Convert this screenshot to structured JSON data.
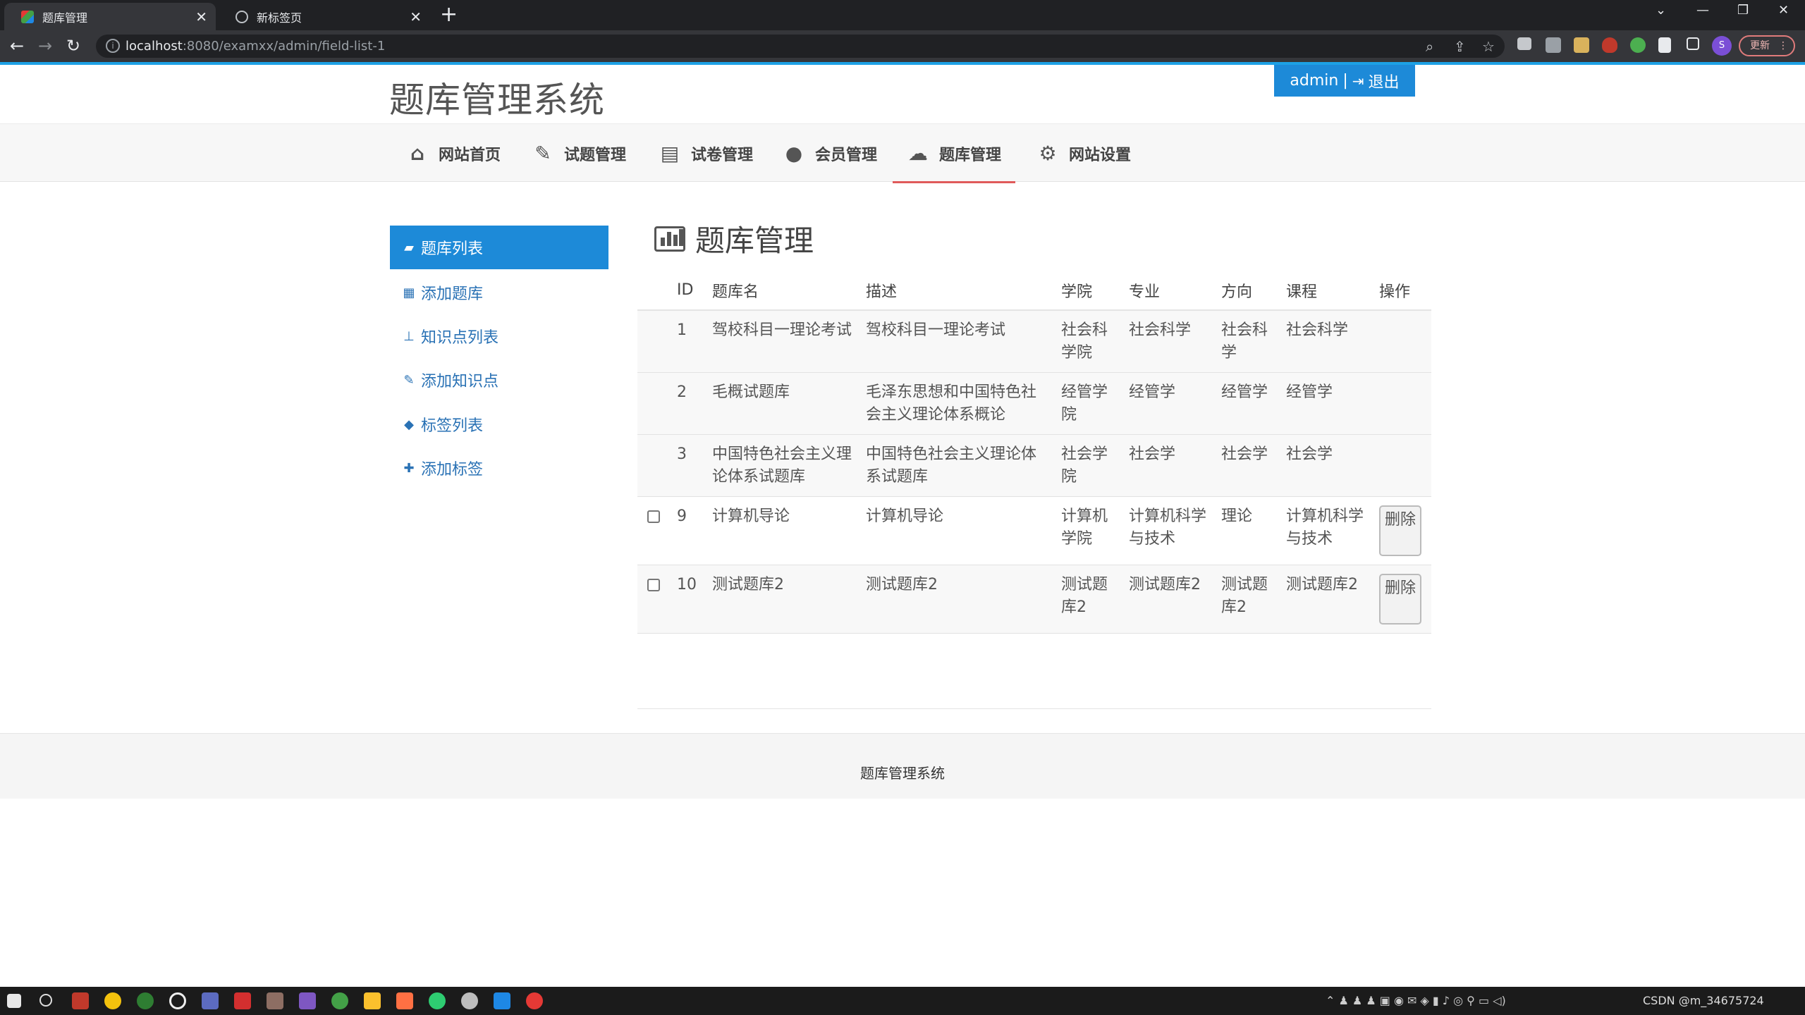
{
  "browser": {
    "tabs": [
      {
        "title": "题库管理",
        "active": true
      },
      {
        "title": "新标签页",
        "active": false
      }
    ],
    "new_tab": "+",
    "url_host": "localhost",
    "url_rest": ":8080/examxx/admin/field-list-1",
    "update_label": "更新",
    "profile_initial": "S"
  },
  "header": {
    "site_title": "题库管理系统",
    "user": "admin",
    "separator": "|",
    "logout": "退出"
  },
  "nav": {
    "items": [
      {
        "label": "网站首页",
        "icon": "home-icon"
      },
      {
        "label": "试题管理",
        "icon": "edit-icon"
      },
      {
        "label": "试卷管理",
        "icon": "document-icon"
      },
      {
        "label": "会员管理",
        "icon": "user-icon"
      },
      {
        "label": "题库管理",
        "icon": "cloud-icon",
        "active": true
      },
      {
        "label": "网站设置",
        "icon": "gears-icon"
      }
    ]
  },
  "sidebar": {
    "items": [
      {
        "label": "题库列表",
        "icon": "book-icon",
        "active": true
      },
      {
        "label": "添加题库",
        "icon": "qrcode-icon"
      },
      {
        "label": "知识点列表",
        "icon": "sitemap-icon"
      },
      {
        "label": "添加知识点",
        "icon": "pencil-icon"
      },
      {
        "label": "标签列表",
        "icon": "tag-icon"
      },
      {
        "label": "添加标签",
        "icon": "plus-icon"
      }
    ]
  },
  "main": {
    "title": "题库管理",
    "title_icon": "bar-chart-icon",
    "table": {
      "headers": [
        "ID",
        "题库名",
        "描述",
        "学院",
        "专业",
        "方向",
        "课程",
        "操作"
      ],
      "rows": [
        {
          "id": "1",
          "name": "驾校科目一理论考试",
          "desc": "驾校科目一理论考试",
          "college": "社会科学院",
          "major": "社会科学",
          "direction": "社会科学",
          "course": "社会科学",
          "deletable": false
        },
        {
          "id": "2",
          "name": "毛概试题库",
          "desc": "毛泽东思想和中国特色社会主义理论体系概论",
          "college": "经管学院",
          "major": "经管学",
          "direction": "经管学",
          "course": "经管学",
          "deletable": false
        },
        {
          "id": "3",
          "name": "中国特色社会主义理论体系试题库",
          "desc": "中国特色社会主义理论体系试题库",
          "college": "社会学院",
          "major": "社会学",
          "direction": "社会学",
          "course": "社会学",
          "deletable": false
        },
        {
          "id": "9",
          "name": "计算机导论",
          "desc": "计算机导论",
          "college": "计算机学院",
          "major": "计算机科学与技术",
          "direction": "理论",
          "course": "计算机科学与技术",
          "deletable": true
        },
        {
          "id": "10",
          "name": "测试题库2",
          "desc": "测试题库2",
          "college": "测试题库2",
          "major": "测试题库2",
          "direction": "测试题库2",
          "course": "测试题库2",
          "deletable": true
        }
      ],
      "delete_label": "删除"
    }
  },
  "footer": {
    "text": "题库管理系统"
  },
  "taskbar": {
    "tray_text": "CSDN @m_34675724"
  },
  "colors": {
    "accent": "#1d8ad8",
    "nav_active_underline": "#e05a5a",
    "link": "#2a72b5"
  }
}
